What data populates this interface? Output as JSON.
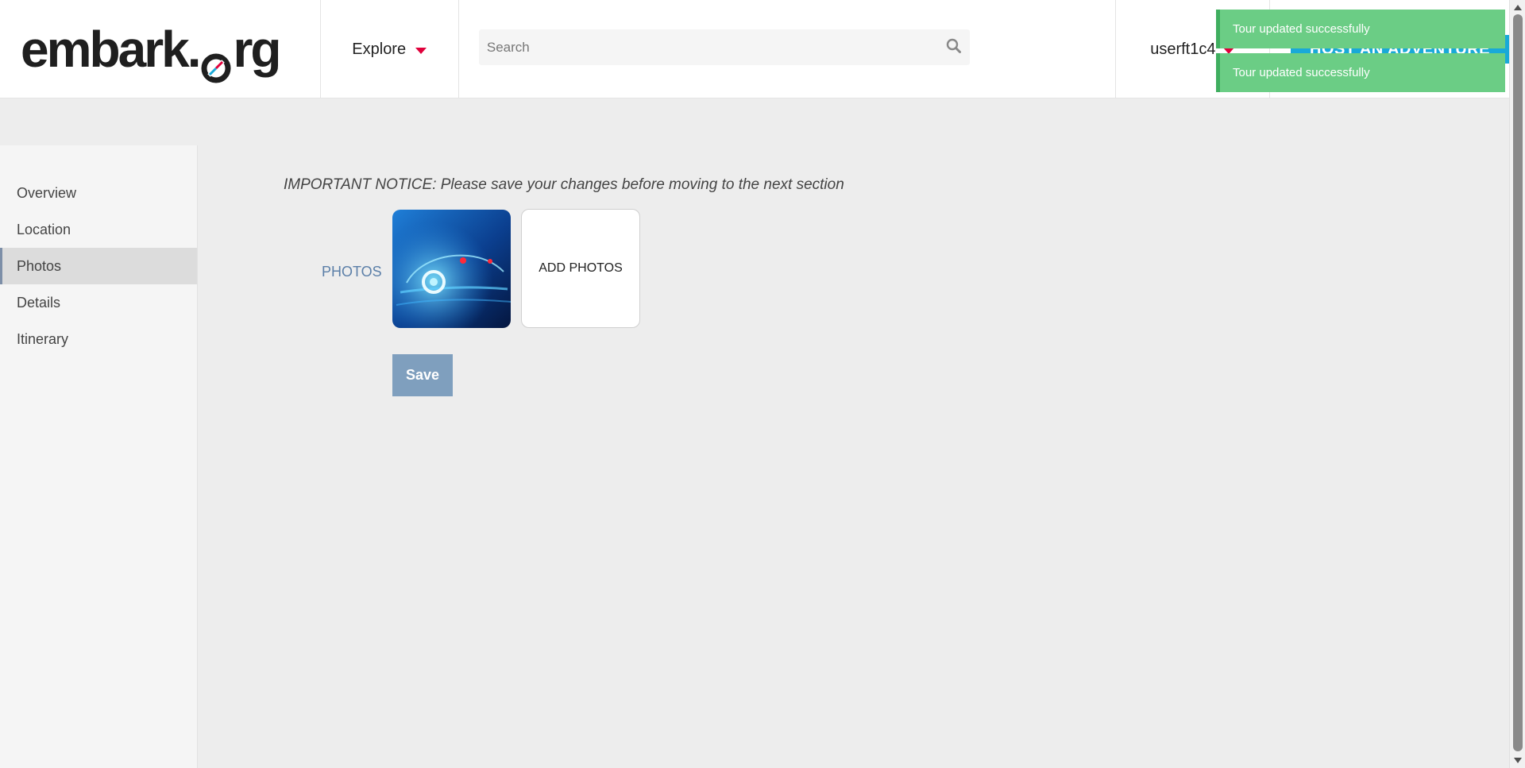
{
  "header": {
    "logo_text": "embark.org",
    "explore_label": "Explore",
    "search": {
      "placeholder": "Search",
      "value": ""
    },
    "user_name": "userft1c4",
    "host_button_label": "HOST AN ADVENTURE"
  },
  "toasts": [
    {
      "message": "Tour updated successfully"
    },
    {
      "message": "Tour updated successfully"
    }
  ],
  "sidebar": {
    "items": [
      {
        "label": "Overview"
      },
      {
        "label": "Location"
      },
      {
        "label": "Photos",
        "active": true
      },
      {
        "label": "Details"
      },
      {
        "label": "Itinerary"
      }
    ]
  },
  "main": {
    "notice": "IMPORTANT NOTICE: Please save your changes before moving to the next section",
    "photos_label": "PHOTOS",
    "add_photos_label": "ADD PHOTOS",
    "save_label": "Save"
  },
  "colors": {
    "accent_red": "#e0003b",
    "host_blue": "#19a9d8",
    "toast_green": "#6bcd85",
    "save_blue": "#7f9fbe",
    "label_blue": "#5b7fa8"
  },
  "icons": {
    "search": "search-icon",
    "explore_caret": "caret-down-icon",
    "user_caret": "caret-down-icon"
  }
}
